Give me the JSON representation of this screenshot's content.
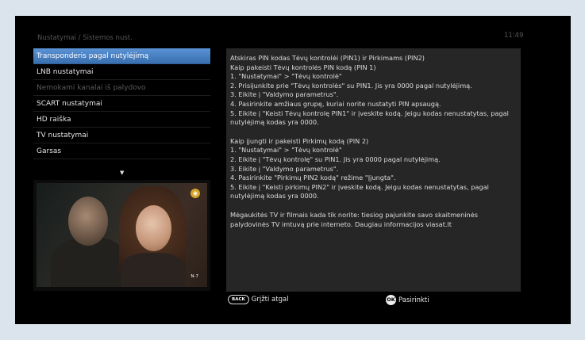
{
  "header": {
    "breadcrumb": "Nustatymai / Sistemos nust.",
    "clock": "11:49"
  },
  "menu": {
    "items": [
      {
        "label": "Transponderis pagal nutylėjimą",
        "state": "selected"
      },
      {
        "label": "LNB nustatymai",
        "state": "normal"
      },
      {
        "label": "Nemokami kanalai iš palydovo",
        "state": "disabled"
      },
      {
        "label": "SCART nustatymai",
        "state": "normal"
      },
      {
        "label": "HD raiška",
        "state": "normal"
      },
      {
        "label": "TV nustatymai",
        "state": "normal"
      },
      {
        "label": "Garsas",
        "state": "normal"
      }
    ],
    "more_indicator": "▼"
  },
  "preview": {
    "age_rating": "N-7",
    "channel_logo": "◉"
  },
  "info": {
    "lines_pin1": [
      "Atskiras PIN kodas Tėvų kontrolėi (PIN1) ir Pirkimams (PIN2)",
      "Kaip pakeisti Tėvų kontrolės PIN kodą (PIN 1)",
      "1. \"Nustatymai\" > \"Tėvų kontrolė\"",
      "2. Prisijunkite prie \"Tėvų kontrolės\" su PIN1. Jis yra 0000 pagal nutylėjimą.",
      "3. Eikite į \"Valdymo parametrus\".",
      "4. Pasirinkite amžiaus grupę, kuriai norite nustatyti PIN apsaugą.",
      "5. Eikite į \"Keisti Tėvų kontrolę PIN1\" ir įveskite kodą.  Jeigu kodas nenustatytas, pagal nutylėjimą kodas yra 0000."
    ],
    "lines_pin2": [
      "Kaip įjungti ir pakeisti Pirkimų kodą (PIN 2)",
      "1. \"Nustatymai\" > \"Tėvų kontrolė\"",
      "2. Eikite į \"Tėvų kontrolę\" su PIN1. Jis yra 0000 pagal nutylėjimą.",
      "3. Eikite į \"Valdymo parametrus\".",
      "4. Pasirinkite \"Pirkimų PIN2 kodą\" režime \"Įjungta\".",
      "5. Eikite į \"Keisti pirkimų PIN2\" ir įveskite kodą. Jeigu kodas nenustatytas, pagal nutylėjimą kodas yra 0000."
    ],
    "promo": "Mėgaukitės TV ir filmais kada tik norite: tiesiog pajunkite savo skaitmeninės palydovinės TV imtuvą prie interneto. Daugiau informacijos  viasat.lt"
  },
  "footer": {
    "back_badge": "BACK",
    "back_label": "Grįžti atgal",
    "ok_badge": "OK",
    "ok_label": "Pasirinkti"
  }
}
